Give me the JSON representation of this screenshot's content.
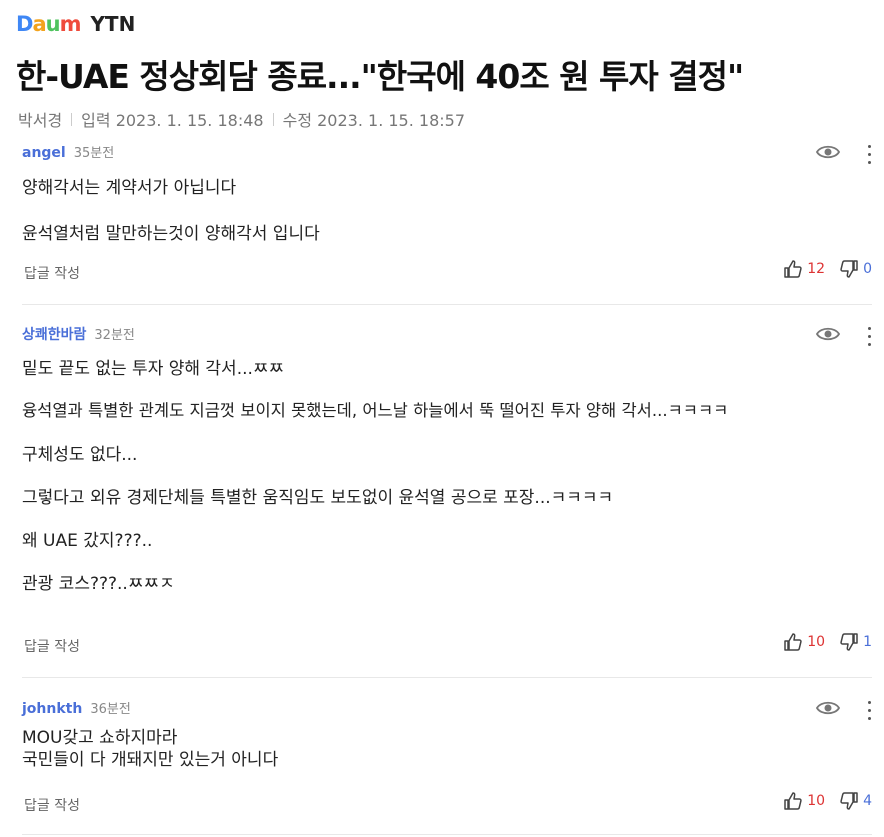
{
  "header": {
    "logo_letters": [
      "D",
      "a",
      "u",
      "m"
    ],
    "logo_colors": [
      "#3f87f5",
      "#f3a31d",
      "#4fc35e",
      "#ef4b3c"
    ],
    "source": "YTN"
  },
  "article": {
    "title": "한-UAE 정상회담 종료...\"한국에 40조 원 투자 결정\"",
    "author": "박서경",
    "published": "입력 2023. 1. 15. 18:48",
    "updated": "수정 2023. 1. 15. 18:57"
  },
  "comments": [
    {
      "author": "angel",
      "time": "35분전",
      "lines": [
        "양해각서는 계약서가 아닙니다",
        "",
        "윤석열처럼 말만하는것이 양해각서 입니다"
      ],
      "reply_label": "답글 작성",
      "likes": "12",
      "dislikes": "0"
    },
    {
      "author": "상쾌한바람",
      "time": "32분전",
      "lines": [
        "밑도 끝도 없는 투자 양해 각서...ㅉㅉ",
        "",
        "융석열과 특별한 관계도 지금껏 보이지 못했는데, 어느날 하늘에서 뚝 떨어진 투자 양해 각서...ㅋㅋㅋㅋ",
        "",
        "구체성도 없다...",
        "",
        "그렇다고 외유 경제단체들 특별한 움직임도 보도없이 윤석열 공으로 포장...ㅋㅋㅋㅋ",
        "",
        "왜 UAE 갔지???..",
        "",
        "관광 코스???..ㅉㅉㅈ"
      ],
      "reply_label": "답글 작성",
      "likes": "10",
      "dislikes": "1"
    },
    {
      "author": "johnkth",
      "time": "36분전",
      "lines": [
        "MOU갖고 쇼하지마라",
        "국민들이 다 개돼지만 있는거 아니다"
      ],
      "reply_label": "답글 작성",
      "likes": "10",
      "dislikes": "4"
    }
  ],
  "icons": {
    "view": "eye-icon",
    "more": "more-vertical-icon",
    "like": "thumbs-up-icon",
    "dislike": "thumbs-down-icon"
  }
}
